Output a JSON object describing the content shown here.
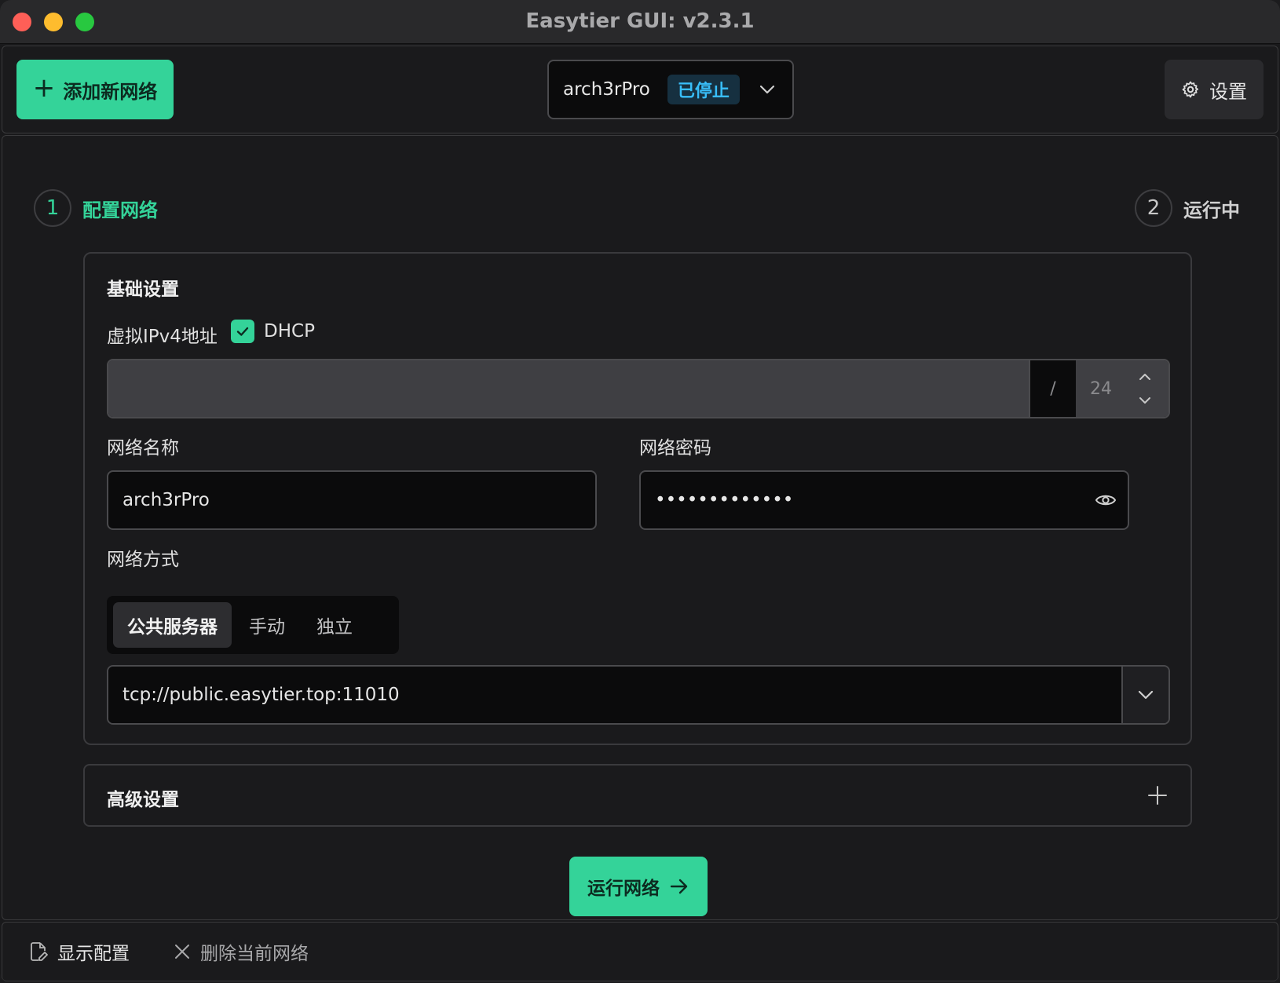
{
  "window": {
    "title": "Easytier GUI: v2.3.1"
  },
  "toolbar": {
    "add_network_label": "添加新网络",
    "network_name": "arch3rPro",
    "network_status": "已停止",
    "settings_label": "设置"
  },
  "steps": [
    {
      "number": "1",
      "label": "配置网络"
    },
    {
      "number": "2",
      "label": "运行中"
    }
  ],
  "basic": {
    "title": "基础设置",
    "ipv4_label": "虚拟IPv4地址",
    "dhcp_checked": true,
    "dhcp_label": "DHCP",
    "ip_value": "",
    "ip_slash": "/",
    "ip_mask": "24",
    "network_name_label": "网络名称",
    "network_name_value": "arch3rPro",
    "network_password_label": "网络密码",
    "network_password_value": "•••••••••••••",
    "network_mode_label": "网络方式",
    "modes": [
      "公共服务器",
      "手动",
      "独立"
    ],
    "selected_mode": "公共服务器",
    "server_value": "tcp://public.easytier.top:11010"
  },
  "advanced": {
    "title": "高级设置"
  },
  "run_button_label": "运行网络",
  "footer": {
    "show_config_label": "显示配置",
    "delete_network_label": "删除当前网络"
  },
  "colors": {
    "accent": "#34d399",
    "status_blue": "#38bdf8",
    "background": "#19191b"
  }
}
